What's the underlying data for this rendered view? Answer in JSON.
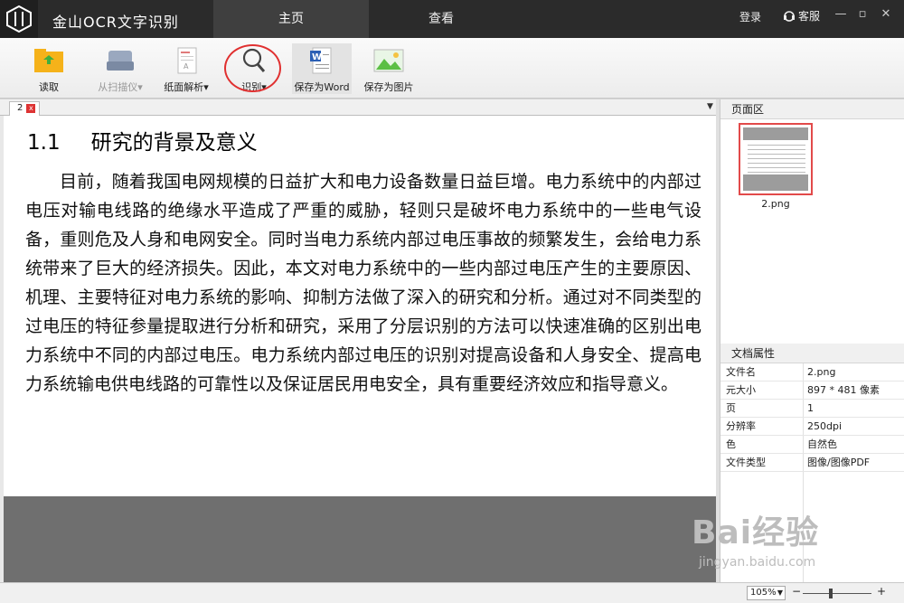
{
  "app": {
    "title": "金山OCR文字识别",
    "tabs": [
      {
        "label": "主页",
        "active": true
      },
      {
        "label": "查看",
        "active": false
      }
    ],
    "login_label": "登录",
    "service_label": "客服",
    "window_controls": [
      "—",
      "▫",
      "✕"
    ]
  },
  "toolbar": {
    "items": [
      {
        "label": "读取",
        "icon": "folder-open-icon",
        "enabled": true
      },
      {
        "label": "从扫描仪",
        "icon": "scanner-icon",
        "enabled": false,
        "has_dropdown": true
      },
      {
        "label": "纸面解析",
        "icon": "paper-analyze-icon",
        "enabled": true,
        "has_dropdown": true
      },
      {
        "label": "识别",
        "icon": "magnifier-icon",
        "enabled": true,
        "has_dropdown": true,
        "highlighted_by_red_circle": true
      },
      {
        "label": "保存为Word",
        "icon": "word-document-icon",
        "enabled": true
      },
      {
        "label": "保存为图片",
        "icon": "image-icon",
        "enabled": true
      }
    ],
    "dropdown_marker": "▾"
  },
  "document": {
    "tab_label": "2",
    "tab_close": "x",
    "tabs_dropdown": "▼",
    "heading_number": "1.1",
    "heading_text": "研究的背景及意义",
    "body": "目前，随着我国电网规模的日益扩大和电力设备数量日益巨增。电力系统中的内部过电压对输电线路的绝缘水平造成了严重的威胁，轻则只是破坏电力系统中的一些电气设备，重则危及人身和电网安全。同时当电力系统内部过电压事故的频繁发生，会给电力系统带来了巨大的经济损失。因此，本文对电力系统中的一些内部过电压产生的主要原因、机理、主要特征对电力系统的影响、抑制方法做了深入的研究和分析。通过对不同类型的过电压的特征参量提取进行分析和研究，采用了分层识别的方法可以快速准确的区别出电力系统中不同的内部过电压。电力系统内部过电压的识别对提高设备和人身安全、提高电力系统输电供电线路的可靠性以及保证居民用电安全，具有重要经济效应和指导意义。"
  },
  "pages_panel": {
    "header": "页面区",
    "thumbnails": [
      {
        "name": "2.png",
        "selected": true
      }
    ]
  },
  "doc_properties": {
    "header": "文档属性",
    "rows": [
      {
        "key": "文件名",
        "value": "2.png"
      },
      {
        "key": "元大小",
        "value": "897 * 481 像素"
      },
      {
        "key": "页",
        "value": "1"
      },
      {
        "key": "分辨率",
        "value": "250dpi"
      },
      {
        "key": "色",
        "value": "自然色"
      },
      {
        "key": "文件类型",
        "value": "图像/图像PDF"
      }
    ]
  },
  "statusbar": {
    "zoom": "105%",
    "zoom_minus": "−",
    "zoom_plus": "+"
  },
  "watermark": {
    "brand": "Bai经验",
    "url": "jingyan.baidu.com"
  },
  "colors": {
    "titlebar": "#2b2b2b",
    "active_tab": "#3f3f3f",
    "highlight_circle": "#e03030",
    "thumb_selected_border": "#e24a4a"
  }
}
